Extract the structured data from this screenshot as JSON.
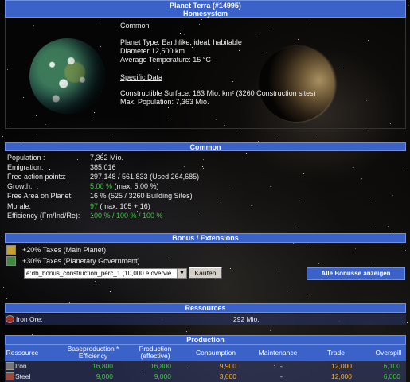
{
  "title": {
    "line1": "Planet Terra (#14995)",
    "line2": "Homesystem"
  },
  "overview": {
    "common_heading": "Common",
    "planet_type": "Planet Type: Earthlike, ideal, habitable",
    "diameter": "Diameter 12,500 km",
    "avg_temp": "Average Temperature: 15 °C",
    "specific_heading": "Specific Data",
    "constructible": "Constructible Surface: 163 Mio. km² (3260 Construction sites)",
    "max_pop": "Max. Population: 7,363 Mio."
  },
  "common": {
    "heading": "Common",
    "rows": [
      {
        "label": "Population :",
        "value": "7,362 Mio.",
        "extra": ""
      },
      {
        "label": "Emigration:",
        "value": "385,016",
        "extra": ""
      },
      {
        "label": "Free action points:",
        "value": "297,148 / 561,833 (Used 264,685)",
        "extra": ""
      },
      {
        "label": "Growth:",
        "value": "5.00 %",
        "extra": " (max. 5.00 %)"
      },
      {
        "label": "Free Area on Planet:",
        "value": "16 % (525 / 3260 Building Sites)",
        "extra": ""
      },
      {
        "label": "Morale:",
        "value": "97",
        "extra": " (max. 105 + 16)"
      },
      {
        "label": "Efficiency (Fm/Ind/Re):",
        "value": "100 % / 100 % / 100 %",
        "extra": ""
      }
    ]
  },
  "bonus": {
    "heading": "Bonus / Extensions",
    "items": [
      {
        "icon": "crown-icon",
        "text": "+20% Taxes (Main Planet)"
      },
      {
        "icon": "money-icon",
        "text": "+30% Taxes (Planetary Government)"
      }
    ],
    "select_value": "e:db_bonus_construction_perc_1 (10,000 e:overvie",
    "buy_label": "Kaufen",
    "show_all_label": "Alle Bonusse anzeigen"
  },
  "resources": {
    "heading": "Ressources",
    "rows": [
      {
        "icon": "iron-ore-icon",
        "name": "Iron Ore:",
        "value": "292 Mio."
      }
    ]
  },
  "production": {
    "heading": "Production",
    "columns": {
      "resource": "Ressource",
      "base1": "Baseproduction *",
      "base2": "Efficiency",
      "prod1": "Production",
      "prod2": "(effective)",
      "consumption": "Consumption",
      "maintenance": "Maintenance",
      "trade": "Trade",
      "overspill": "Overspill"
    },
    "rows": [
      {
        "icon": "iron-icon",
        "name": "Iron",
        "base": "16,800",
        "prod": "16,800",
        "consumption": "9,900",
        "maintenance": "-",
        "trade": "12,000",
        "overspill": "6,100"
      },
      {
        "icon": "steel-icon",
        "name": "Steel",
        "base": "9,000",
        "prod": "9,000",
        "consumption": "3,600",
        "maintenance": "-",
        "trade": "12,000",
        "overspill": "6,000"
      }
    ]
  },
  "colors": {
    "header_blue": "#3a62c9",
    "green_value": "#3ec83e",
    "orange_value": "#ffb030"
  }
}
